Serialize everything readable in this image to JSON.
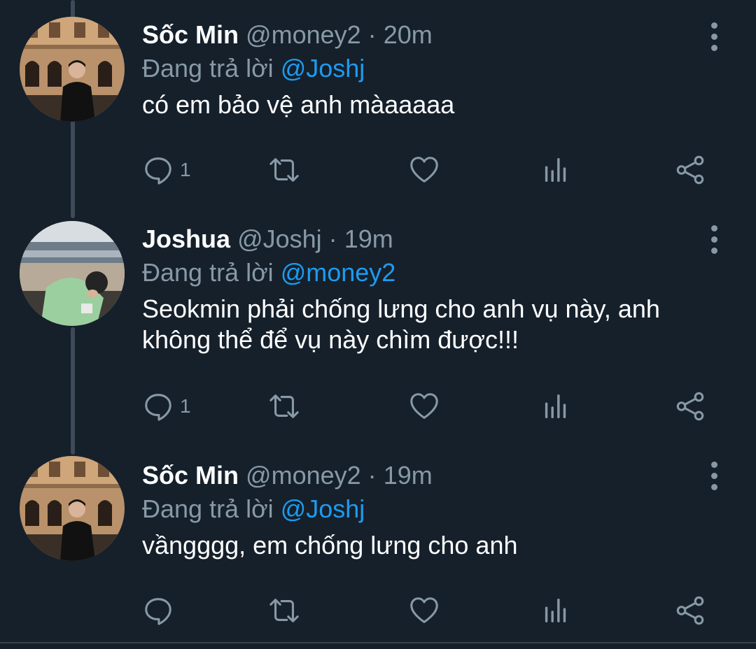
{
  "tweets": [
    {
      "display_name": "Sốc Min",
      "handle": "@money2",
      "separator": "·",
      "time": "20m",
      "reply_prefix": "Đang trả lời",
      "reply_to": "@Joshj",
      "text": "có em bảo vệ anh màaaaaa",
      "reply_count": "1",
      "avatar": "avatar-building-photo"
    },
    {
      "display_name": "Joshua",
      "handle": "@Joshj",
      "separator": "·",
      "time": "19m",
      "reply_prefix": "Đang trả lời",
      "reply_to": "@money2",
      "text": "Seokmin phải chống lưng cho anh vụ này, anh\nkhông thể để vụ này chìm được!!!",
      "reply_count": "1",
      "avatar": "avatar-beach-photo"
    },
    {
      "display_name": "Sốc Min",
      "handle": "@money2",
      "separator": "·",
      "time": "19m",
      "reply_prefix": "Đang trả lời",
      "reply_to": "@Joshj",
      "text": "vầngggg, em chống lưng cho anh",
      "reply_count": "",
      "avatar": "avatar-building-photo"
    }
  ],
  "icons": {
    "reply": "reply-icon",
    "retweet": "retweet-icon",
    "like": "heart-icon",
    "analytics": "analytics-icon",
    "share": "share-icon",
    "more": "more-vertical-icon"
  },
  "colors": {
    "background": "#15202b",
    "primary_text": "#ffffff",
    "secondary_text": "#8899a6",
    "accent": "#1d9bf0",
    "thread_line": "#3d4a57",
    "divider": "#38444d"
  }
}
